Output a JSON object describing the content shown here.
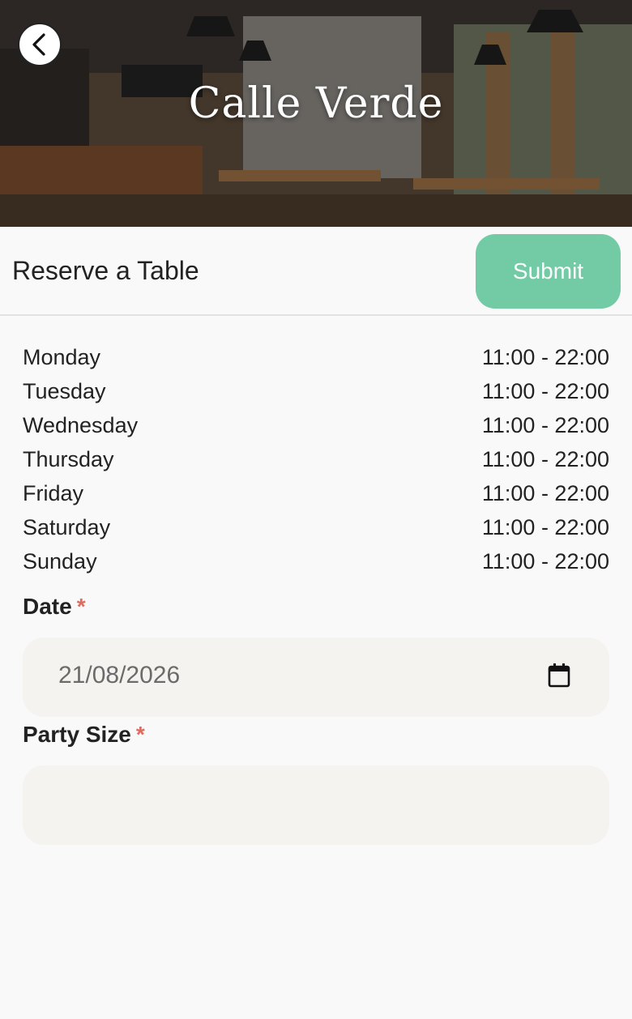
{
  "header": {
    "restaurant_name": "Calle Verde"
  },
  "toolbar": {
    "title": "Reserve a Table",
    "submit_label": "Submit"
  },
  "hours": [
    {
      "day": "Monday",
      "time": "11:00 - 22:00"
    },
    {
      "day": "Tuesday",
      "time": "11:00 - 22:00"
    },
    {
      "day": "Wednesday",
      "time": "11:00 - 22:00"
    },
    {
      "day": "Thursday",
      "time": "11:00 - 22:00"
    },
    {
      "day": "Friday",
      "time": "11:00 - 22:00"
    },
    {
      "day": "Saturday",
      "time": "11:00 - 22:00"
    },
    {
      "day": "Sunday",
      "time": "11:00 - 22:00"
    }
  ],
  "form": {
    "date": {
      "label": "Date",
      "required_mark": "*",
      "value": "21/08/2026"
    },
    "party_size": {
      "label": "Party Size",
      "required_mark": "*",
      "value": ""
    }
  },
  "colors": {
    "accent": "#72cba5",
    "required": "#e06a5e",
    "input_bg": "#f4f3f0"
  },
  "icons": {
    "back": "chevron-left-icon",
    "calendar": "calendar-icon"
  }
}
